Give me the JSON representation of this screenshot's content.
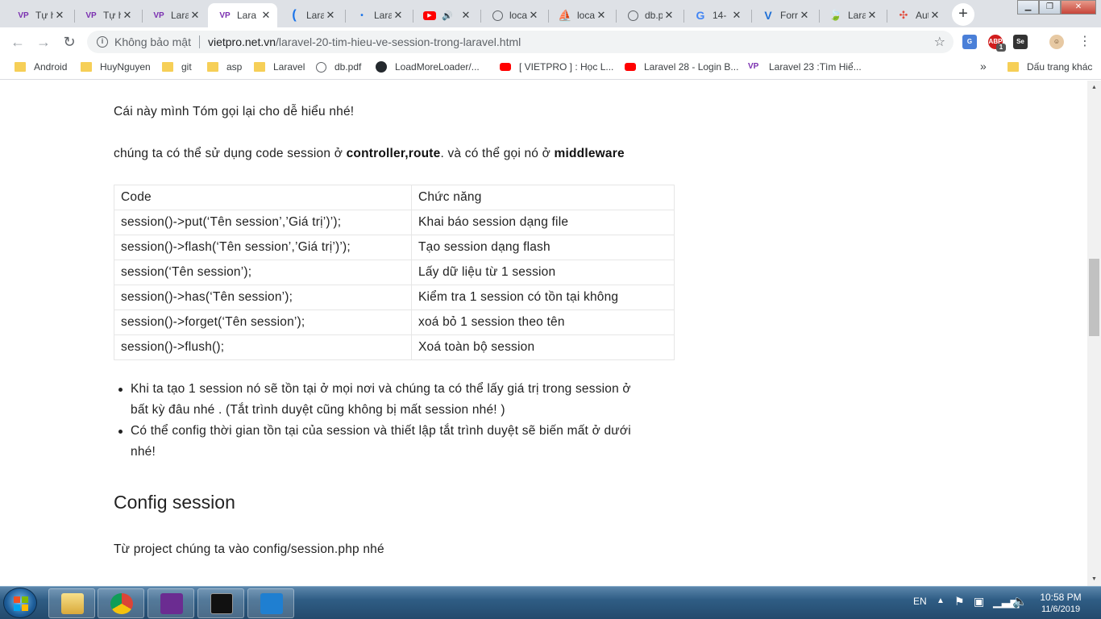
{
  "tabs": [
    {
      "title": "Tự h",
      "favicon": "VP",
      "active": false
    },
    {
      "title": "Tự h",
      "favicon": "VP",
      "active": false
    },
    {
      "title": "Lara",
      "favicon": "VP",
      "active": false
    },
    {
      "title": "Lara",
      "favicon": "VP",
      "active": true
    },
    {
      "title": "Lara",
      "favicon": "loading",
      "active": false
    },
    {
      "title": "Lara",
      "favicon": "loading-dot",
      "active": false
    },
    {
      "title": "",
      "favicon": "youtube-audio",
      "active": false
    },
    {
      "title": "loca",
      "favicon": "globe",
      "active": false
    },
    {
      "title": "loca",
      "favicon": "pma",
      "active": false
    },
    {
      "title": "db.p",
      "favicon": "globe",
      "active": false
    },
    {
      "title": "14-",
      "favicon": "G",
      "active": false
    },
    {
      "title": "Forr",
      "favicon": "V",
      "active": false
    },
    {
      "title": "Lara",
      "favicon": "leaf",
      "active": false
    },
    {
      "title": "Aut",
      "favicon": "pinwheel",
      "active": false
    }
  ],
  "toolbar": {
    "security_label": "Không bảo mật",
    "url_host": "vietpro.net.vn",
    "url_path": "/laravel-20-tim-hieu-ve-session-trong-laravel.html",
    "ext_badge": "1"
  },
  "bookmarks": [
    {
      "label": "Android",
      "icon": "folder"
    },
    {
      "label": "HuyNguyen",
      "icon": "folder"
    },
    {
      "label": "git",
      "icon": "folder"
    },
    {
      "label": "asp",
      "icon": "folder"
    },
    {
      "label": "Laravel",
      "icon": "folder"
    },
    {
      "label": "db.pdf",
      "icon": "globe"
    },
    {
      "label": "LoadMoreLoader/...",
      "icon": "github"
    },
    {
      "label": "[ VIETPRO ] : Học L...",
      "icon": "youtube"
    },
    {
      "label": "Laravel 28 - Login B...",
      "icon": "youtube"
    },
    {
      "label": "Laravel 23 :Tìm Hiể...",
      "icon": "vp"
    }
  ],
  "bookmarks_other": "Dấu trang khác",
  "article": {
    "intro": "Cái này mình Tóm gọi lại cho dễ hiểu nhé!",
    "usage_prefix": "chúng ta có thể sử dụng code session ở ",
    "usage_bold1": "controller,route",
    "usage_mid": ". và có thể gọi nó ở ",
    "usage_bold2": "middleware",
    "table": {
      "headers": [
        "Code",
        "Chức năng"
      ],
      "rows": [
        [
          "session()->put(‘Tên session’,’Giá trị’)’);",
          "Khai báo session dạng file"
        ],
        [
          "session()->flash(‘Tên session’,’Giá trị’)’);",
          "Tạo session dạng flash"
        ],
        [
          "session(‘Tên session’);",
          "Lấy dữ liệu từ 1 session"
        ],
        [
          "session()->has(‘Tên session’);",
          "Kiểm tra 1 session có tồn tại không"
        ],
        [
          "session()->forget(‘Tên session’);",
          "xoá bỏ 1 session theo tên"
        ],
        [
          "session()->flush();",
          "Xoá toàn bộ session"
        ]
      ]
    },
    "notes": [
      {
        "line1": "Khi ta tạo 1 session nó sẽ tồn tại ở mọi nơi và chúng ta có thể lấy giá trị trong session ở",
        "line2": "bất kỳ đâu nhé . (Tắt trình duyệt cũng không bị mất session nhé! )"
      },
      {
        "line1": "Có thể config thời gian tồn tại của session và thiết lập tắt trình duyệt sẽ biến mất ở dưới",
        "line2": "nhé!"
      }
    ],
    "heading": "Config session",
    "config_text": "Từ project chúng ta vào config/session.php nhé"
  },
  "taskbar": {
    "apps": [
      "file-explorer",
      "chrome",
      "media-app",
      "command-prompt",
      "vscode"
    ],
    "lang": "EN",
    "time": "10:58 PM",
    "date": "11/6/2019"
  }
}
